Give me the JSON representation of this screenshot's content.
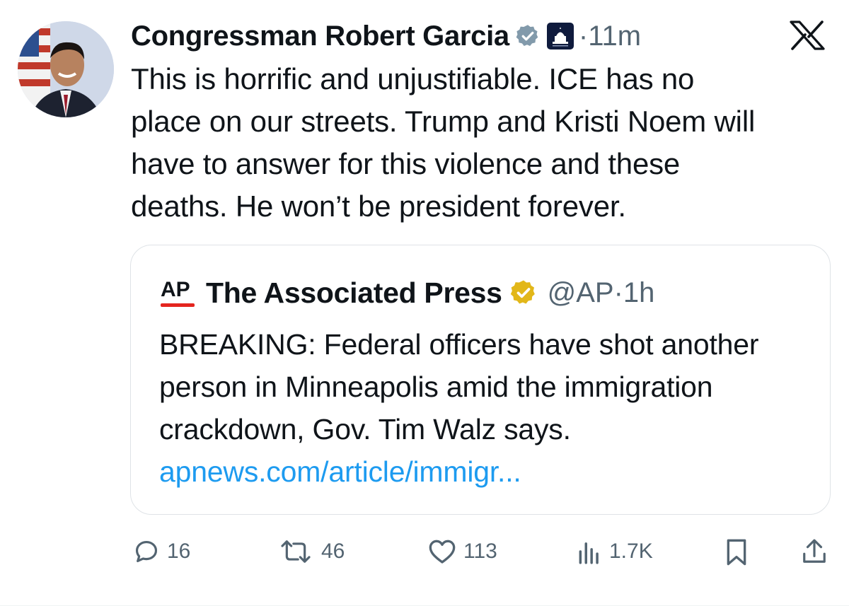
{
  "author": {
    "name": "Congressman Robert Garcia",
    "separator": "·",
    "time": "11m"
  },
  "tweet": {
    "text": "This is horrific and unjustifiable. ICE has no\nplace on our streets. Trump and Kristi Noem will\nhave to answer for this violence and these\ndeaths. He won’t be president forever."
  },
  "quote": {
    "logo_text": "AP",
    "name": "The Associated Press",
    "handle": "@AP",
    "separator": "·",
    "time": "1h",
    "text": "BREAKING: Federal officers have shot another person in Minneapolis amid the immigration crackdown, Gov. Tim Walz says.",
    "link": "apnews.com/article/immigr..."
  },
  "actions": {
    "replies": "16",
    "reposts": "46",
    "likes": "113",
    "views": "1.7K"
  },
  "icons": [
    "verified-badge-icon",
    "capitol-icon",
    "x-logo-icon",
    "ap-logo-icon",
    "reply-icon",
    "repost-icon",
    "like-icon",
    "views-icon",
    "bookmark-icon",
    "share-icon"
  ],
  "colors": {
    "text": "#0f1419",
    "secondary": "#536471",
    "link": "#1d9bf0",
    "gold_badge": "#e2b719",
    "gray_badge": "#829aab",
    "ap_red": "#e4251f"
  }
}
